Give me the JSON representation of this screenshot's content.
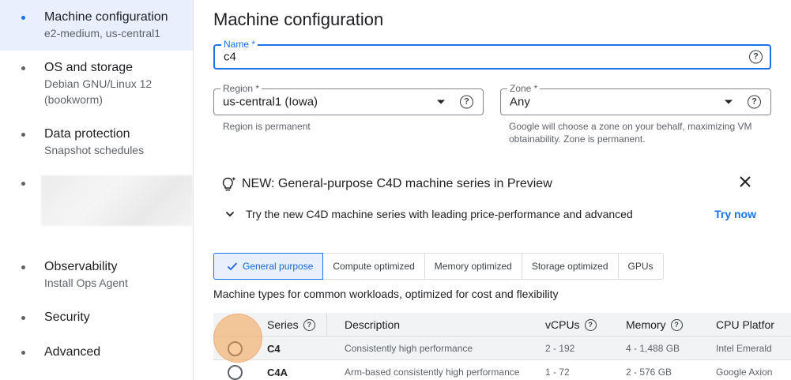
{
  "sidebar": {
    "items": [
      {
        "title": "Machine configuration",
        "subtitle": "e2-medium, us-central1"
      },
      {
        "title": "OS and storage",
        "subtitle": "Debian GNU/Linux 12 (bookworm)"
      },
      {
        "title": "Data protection",
        "subtitle": "Snapshot schedules"
      },
      {
        "title": "Observability",
        "subtitle": "Install Ops Agent"
      },
      {
        "title": "Security",
        "subtitle": ""
      },
      {
        "title": "Advanced",
        "subtitle": ""
      }
    ]
  },
  "main": {
    "title": "Machine configuration",
    "name_field": {
      "label": "Name *",
      "value": "c4"
    },
    "region_field": {
      "label": "Region *",
      "value": "us-central1 (Iowa)",
      "hint": "Region is permanent"
    },
    "zone_field": {
      "label": "Zone *",
      "value": "Any",
      "hint": "Google will choose a zone on your behalf, maximizing VM obtainability. Zone is permanent."
    },
    "banner": {
      "title": "NEW: General-purpose C4D machine series in Preview",
      "body": "Try the new C4D machine series with leading price-performance and advanced",
      "action": "Try now"
    },
    "tabs": [
      {
        "label": "General purpose",
        "selected": true
      },
      {
        "label": "Compute optimized"
      },
      {
        "label": "Memory optimized"
      },
      {
        "label": "Storage optimized"
      },
      {
        "label": "GPUs"
      }
    ],
    "tab_description": "Machine types for common workloads, optimized for cost and flexibility",
    "table": {
      "headers": {
        "series": "Series",
        "description": "Description",
        "vcpus": "vCPUs",
        "memory": "Memory",
        "cpu_platform": "CPU Platfor"
      },
      "rows": [
        {
          "series": "C4",
          "description": "Consistently high performance",
          "vcpus": "2 - 192",
          "memory": "4 - 1,488 GB",
          "cpu_platform": "Intel Emerald"
        },
        {
          "series": "C4A",
          "description": "Arm-based consistently high performance",
          "vcpus": "1 - 72",
          "memory": "2 - 576 GB",
          "cpu_platform": "Google Axion"
        }
      ]
    }
  },
  "colors": {
    "accent": "#1a73e8",
    "selected_bg": "#e8f0fe",
    "ripple": "#f4a050"
  }
}
